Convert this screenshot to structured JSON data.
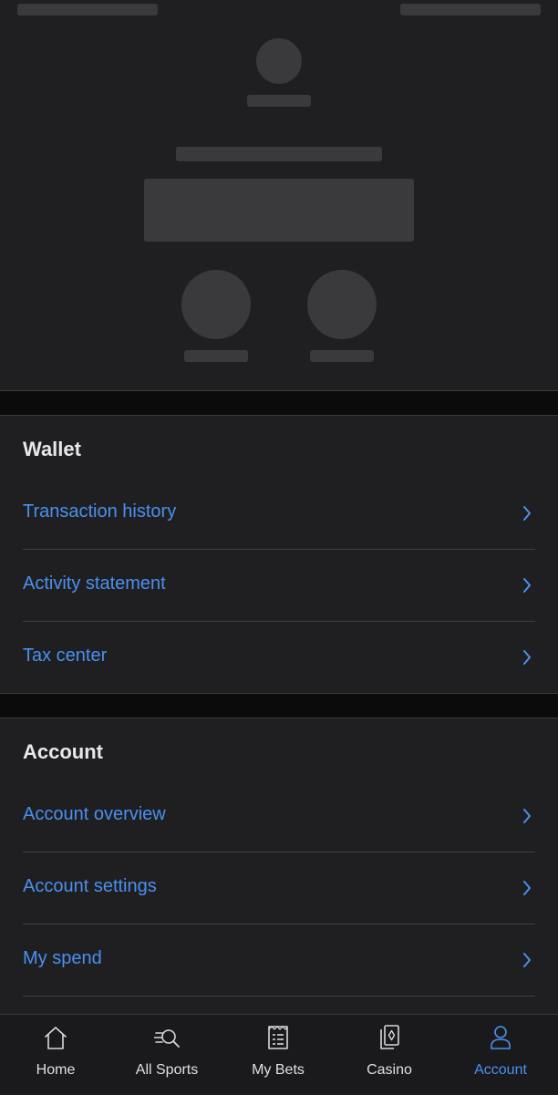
{
  "wallet": {
    "title": "Wallet",
    "items": [
      {
        "label": "Transaction history"
      },
      {
        "label": "Activity statement"
      },
      {
        "label": "Tax center"
      }
    ]
  },
  "account": {
    "title": "Account",
    "items": [
      {
        "label": "Account overview"
      },
      {
        "label": "Account settings"
      },
      {
        "label": "My spend"
      }
    ]
  },
  "bottom_nav": {
    "active": "Account",
    "items": [
      {
        "label": "Home",
        "icon": "home-icon"
      },
      {
        "label": "All Sports",
        "icon": "search-sports-icon"
      },
      {
        "label": "My Bets",
        "icon": "bet-slip-icon"
      },
      {
        "label": "Casino",
        "icon": "cards-icon"
      },
      {
        "label": "Account",
        "icon": "person-icon"
      }
    ]
  },
  "colors": {
    "accent": "#4a90f0",
    "background": "#1f1f21",
    "skeleton": "#3a3a3d",
    "separator": "#0b0b0c"
  }
}
